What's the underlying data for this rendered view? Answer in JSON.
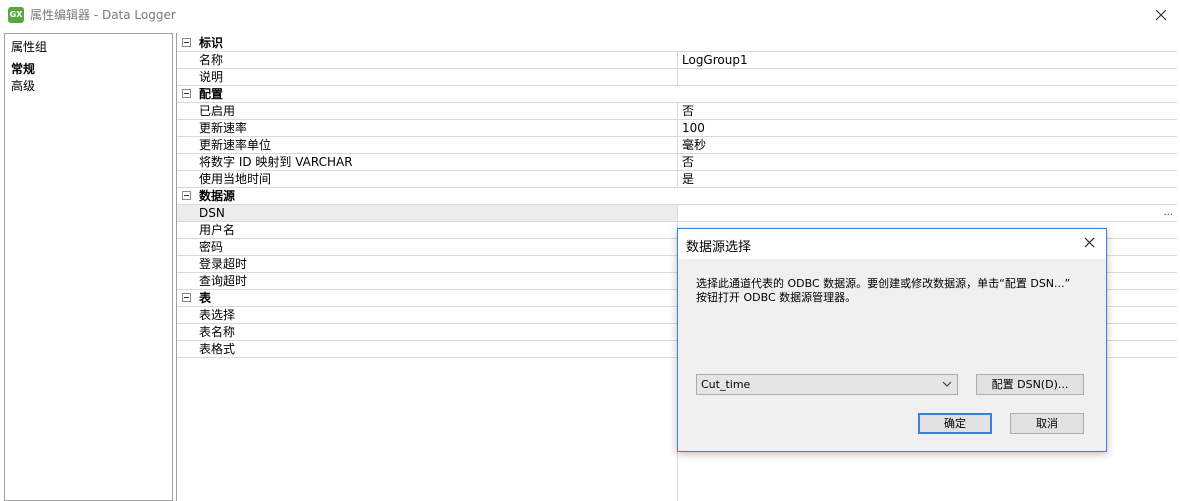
{
  "window": {
    "app_icon_text": "GX",
    "title": "属性编辑器 - Data Logger"
  },
  "left_panel": {
    "heading": "属性组",
    "items": [
      {
        "label": "常规",
        "selected": true
      },
      {
        "label": "高级",
        "selected": false
      }
    ]
  },
  "grid": {
    "categories": [
      {
        "name": "标识",
        "properties": [
          {
            "name": "名称",
            "value": "LogGroup1"
          },
          {
            "name": "说明",
            "value": ""
          }
        ]
      },
      {
        "name": "配置",
        "properties": [
          {
            "name": "已启用",
            "value": "否"
          },
          {
            "name": "更新速率",
            "value": "100"
          },
          {
            "name": "更新速率单位",
            "value": "毫秒"
          },
          {
            "name": "将数字 ID 映射到 VARCHAR",
            "value": "否"
          },
          {
            "name": "使用当地时间",
            "value": "是"
          }
        ]
      },
      {
        "name": "数据源",
        "properties": [
          {
            "name": "DSN",
            "value": "",
            "ellipsis": "..."
          },
          {
            "name": "用户名",
            "value": ""
          },
          {
            "name": "密码",
            "value": ""
          },
          {
            "name": "登录超时",
            "value": ""
          },
          {
            "name": "查询超时",
            "value": ""
          }
        ]
      },
      {
        "name": "表",
        "properties": [
          {
            "name": "表选择",
            "value": ""
          },
          {
            "name": "表名称",
            "value": ""
          },
          {
            "name": "表格式",
            "value": ""
          }
        ]
      }
    ]
  },
  "dialog": {
    "title": "数据源选择",
    "description_line1": "选择此通道代表的 ODBC 数据源。要创建或修改数据源，单击“配置 DSN...”",
    "description_line2": "按钮打开 ODBC 数据源管理器。",
    "dsn_selected": "Cut_time",
    "configure_button": "配置 DSN(D)...",
    "ok_button": "确定",
    "cancel_button": "取消"
  },
  "colors": {
    "dialog_border": "#3c7fd8",
    "selected_row": "#ececec",
    "grid_line": "#d9d9d9"
  }
}
